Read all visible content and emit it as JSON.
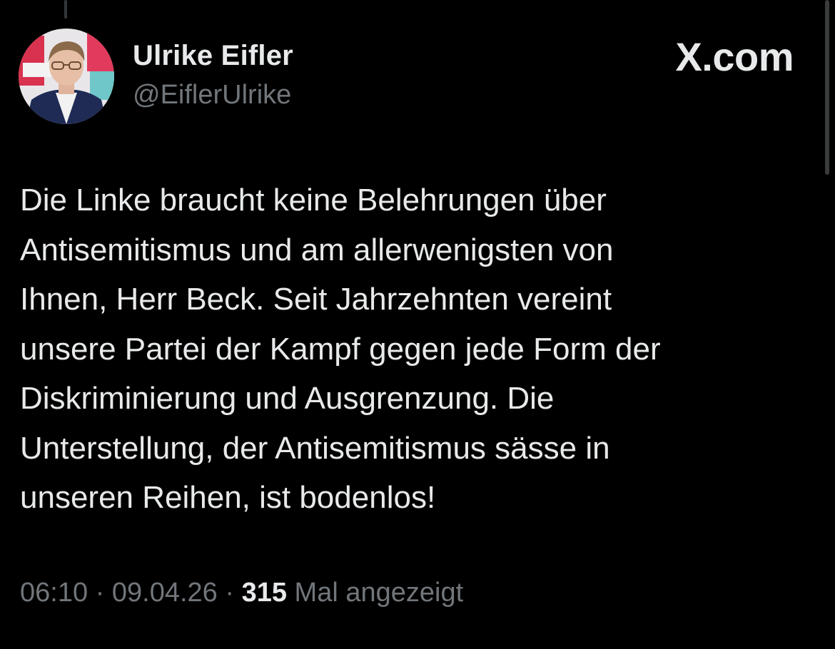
{
  "author": {
    "display_name": "Ulrike Eifler",
    "handle": "@EiflerUlrike"
  },
  "brand": {
    "icon": "x-logo-icon",
    "text": "X.com"
  },
  "tweet": {
    "text": "Die Linke braucht keine Belehrungen über\nAntisemitismus und am allerwenigsten von\nIhnen, Herr Beck. Seit Jahrzehnten vereint\nunsere Partei der Kampf gegen jede Form der\nDiskriminierung und Ausgrenzung. Die\nUnterstellung, der Antisemitismus sässe in\nunseren Reihen, ist bodenlos!"
  },
  "meta": {
    "time": "06:10",
    "separator": " · ",
    "date": "09.04.26",
    "views_count": "315",
    "views_label": " Mal angezeigt"
  },
  "colors": {
    "background": "#000000",
    "primary_text": "#e7e9ea",
    "secondary_text": "#71767b"
  }
}
